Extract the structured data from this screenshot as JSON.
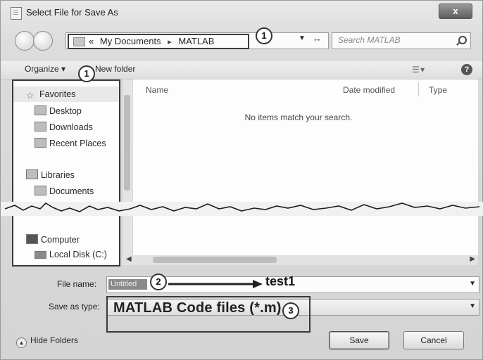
{
  "window": {
    "title": "Select File for Save As",
    "close_label": "x"
  },
  "address": {
    "chevrons": "«",
    "crumbs": [
      "My Documents",
      "MATLAB"
    ],
    "separator": "▸"
  },
  "search": {
    "placeholder": "Search MATLAB"
  },
  "toolbar": {
    "organize_label": "Organize ▾",
    "new_folder_label": "New folder",
    "help_label": "?"
  },
  "sidebar": {
    "favorites": "Favorites",
    "items": [
      {
        "label": "Desktop",
        "icon": "desktop-icon"
      },
      {
        "label": "Downloads",
        "icon": "downloads-icon"
      },
      {
        "label": "Recent Places",
        "icon": "recent-places-icon"
      }
    ],
    "libraries": "Libraries",
    "library_items": [
      {
        "label": "Documents",
        "icon": "documents-icon"
      }
    ],
    "computer": "Computer",
    "computer_items": [
      {
        "label": "Local Disk (C:)",
        "icon": "disk-icon"
      }
    ]
  },
  "content": {
    "columns": [
      "Name",
      "Date modified",
      "Type"
    ],
    "empty_message": "No items match your search."
  },
  "form": {
    "file_name_label": "File name:",
    "file_name_value": "Untitled",
    "save_as_type_label": "Save as type:",
    "save_as_type_value": "MATLAB Code files (*.m)"
  },
  "annotations": {
    "badge_1": "1",
    "badge_1b": "1",
    "badge_2": "2",
    "badge_3": "3",
    "arrow_text": "test1"
  },
  "footer": {
    "hide_folders": "Hide Folders",
    "save_label": "Save",
    "cancel_label": "Cancel"
  }
}
